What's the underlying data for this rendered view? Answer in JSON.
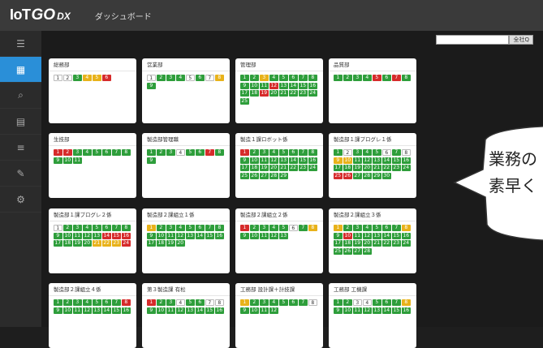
{
  "header": {
    "logo_iot": "IoT",
    "logo_go": "GO",
    "logo_dx": "DX",
    "title": "ダッシュボード"
  },
  "sidebar": {
    "icons": [
      "menu-icon",
      "dashboard-icon",
      "search-icon",
      "calendar-icon",
      "list-icon",
      "edit-icon",
      "gear-icon"
    ]
  },
  "search": {
    "value": "",
    "button": "全社Q"
  },
  "cards": [
    {
      "title": "総務部",
      "cells": [
        [
          "1",
          "w"
        ],
        [
          "2",
          "w"
        ],
        [
          "3",
          "g"
        ],
        [
          "4",
          "y"
        ],
        [
          "5",
          "y"
        ],
        [
          "6",
          "r"
        ]
      ]
    },
    {
      "title": "営業部",
      "cells": [
        [
          "1",
          "w"
        ],
        [
          "2",
          "g"
        ],
        [
          "3",
          "g"
        ],
        [
          "4",
          "g"
        ],
        [
          "5",
          "w"
        ],
        [
          "6",
          "g"
        ],
        [
          "7",
          "w"
        ],
        [
          "8",
          "y"
        ],
        [
          "9",
          "g"
        ]
      ]
    },
    {
      "title": "管理部",
      "cells": [
        [
          "1",
          "g"
        ],
        [
          "2",
          "g"
        ],
        [
          "3",
          "y"
        ],
        [
          "4",
          "g"
        ],
        [
          "5",
          "g"
        ],
        [
          "6",
          "g"
        ],
        [
          "7",
          "g"
        ],
        [
          "8",
          "g"
        ],
        [
          "9",
          "g"
        ],
        [
          "10",
          "g"
        ],
        [
          "11",
          "g"
        ],
        [
          "12",
          "r"
        ],
        [
          "13",
          "g"
        ],
        [
          "14",
          "g"
        ],
        [
          "15",
          "g"
        ],
        [
          "16",
          "g"
        ],
        [
          "17",
          "g"
        ],
        [
          "18",
          "g"
        ],
        [
          "19",
          "r"
        ],
        [
          "20",
          "g"
        ],
        [
          "21",
          "g"
        ],
        [
          "22",
          "g"
        ],
        [
          "23",
          "g"
        ],
        [
          "24",
          "g"
        ],
        [
          "25",
          "g"
        ]
      ]
    },
    {
      "title": "品質部",
      "cells": [
        [
          "1",
          "g"
        ],
        [
          "2",
          "g"
        ],
        [
          "3",
          "g"
        ],
        [
          "4",
          "g"
        ],
        [
          "5",
          "r"
        ],
        [
          "6",
          "g"
        ],
        [
          "7",
          "r"
        ],
        [
          "8",
          "g"
        ]
      ]
    },
    {
      "title": "生技部",
      "cells": [
        [
          "1",
          "r"
        ],
        [
          "2",
          "r"
        ],
        [
          "3",
          "g"
        ],
        [
          "4",
          "g"
        ],
        [
          "5",
          "g"
        ],
        [
          "6",
          "g"
        ],
        [
          "7",
          "g"
        ],
        [
          "8",
          "g"
        ],
        [
          "9",
          "g"
        ],
        [
          "10",
          "g"
        ],
        [
          "11",
          "g"
        ]
      ]
    },
    {
      "title": "製造部管理職",
      "cells": [
        [
          "1",
          "g"
        ],
        [
          "2",
          "g"
        ],
        [
          "3",
          "g"
        ],
        [
          "4",
          "w"
        ],
        [
          "5",
          "g"
        ],
        [
          "6",
          "g"
        ],
        [
          "7",
          "r"
        ],
        [
          "8",
          "g"
        ],
        [
          "9",
          "g"
        ]
      ]
    },
    {
      "title": "製造１課ロボット係",
      "cells": [
        [
          "1",
          "r"
        ],
        [
          "2",
          "g"
        ],
        [
          "3",
          "g"
        ],
        [
          "4",
          "g"
        ],
        [
          "5",
          "g"
        ],
        [
          "6",
          "g"
        ],
        [
          "7",
          "g"
        ],
        [
          "8",
          "g"
        ],
        [
          "9",
          "g"
        ],
        [
          "10",
          "g"
        ],
        [
          "11",
          "g"
        ],
        [
          "12",
          "g"
        ],
        [
          "13",
          "g"
        ],
        [
          "14",
          "g"
        ],
        [
          "15",
          "g"
        ],
        [
          "16",
          "g"
        ],
        [
          "17",
          "g"
        ],
        [
          "18",
          "g"
        ],
        [
          "19",
          "g"
        ],
        [
          "20",
          "g"
        ],
        [
          "21",
          "g"
        ],
        [
          "22",
          "g"
        ],
        [
          "23",
          "g"
        ],
        [
          "24",
          "g"
        ],
        [
          "25",
          "g"
        ],
        [
          "26",
          "g"
        ],
        [
          "27",
          "g"
        ],
        [
          "28",
          "g"
        ],
        [
          "29",
          "g"
        ]
      ]
    },
    {
      "title": "製造部１課プログレ１係",
      "cells": [
        [
          "1",
          "g"
        ],
        [
          "2",
          "w"
        ],
        [
          "3",
          "g"
        ],
        [
          "4",
          "g"
        ],
        [
          "5",
          "g"
        ],
        [
          "6",
          "w"
        ],
        [
          "7",
          "g"
        ],
        [
          "8",
          "w"
        ],
        [
          "9",
          "y"
        ],
        [
          "10",
          "y"
        ],
        [
          "11",
          "g"
        ],
        [
          "12",
          "g"
        ],
        [
          "13",
          "g"
        ],
        [
          "14",
          "g"
        ],
        [
          "15",
          "g"
        ],
        [
          "16",
          "g"
        ],
        [
          "17",
          "g"
        ],
        [
          "18",
          "g"
        ],
        [
          "19",
          "g"
        ],
        [
          "20",
          "g"
        ],
        [
          "21",
          "g"
        ],
        [
          "22",
          "g"
        ],
        [
          "23",
          "g"
        ],
        [
          "24",
          "g"
        ],
        [
          "25",
          "r"
        ],
        [
          "26",
          "r"
        ],
        [
          "27",
          "g"
        ],
        [
          "28",
          "g"
        ],
        [
          "29",
          "g"
        ],
        [
          "30",
          "g"
        ]
      ]
    },
    {
      "title": "製造部１課プログレ２係",
      "cells": [
        [
          "1",
          "w"
        ],
        [
          "2",
          "g"
        ],
        [
          "3",
          "g"
        ],
        [
          "4",
          "g"
        ],
        [
          "5",
          "g"
        ],
        [
          "6",
          "g"
        ],
        [
          "7",
          "g"
        ],
        [
          "8",
          "g"
        ],
        [
          "9",
          "g"
        ],
        [
          "10",
          "g"
        ],
        [
          "11",
          "g"
        ],
        [
          "12",
          "g"
        ],
        [
          "13",
          "g"
        ],
        [
          "14",
          "r"
        ],
        [
          "15",
          "r"
        ],
        [
          "16",
          "r"
        ],
        [
          "17",
          "g"
        ],
        [
          "18",
          "g"
        ],
        [
          "19",
          "g"
        ],
        [
          "20",
          "g"
        ],
        [
          "21",
          "y"
        ],
        [
          "22",
          "y"
        ],
        [
          "23",
          "y"
        ],
        [
          "24",
          "r"
        ]
      ]
    },
    {
      "title": "製造部２課組立１係",
      "cells": [
        [
          "1",
          "y"
        ],
        [
          "2",
          "g"
        ],
        [
          "3",
          "g"
        ],
        [
          "4",
          "g"
        ],
        [
          "5",
          "g"
        ],
        [
          "6",
          "g"
        ],
        [
          "7",
          "g"
        ],
        [
          "8",
          "g"
        ],
        [
          "9",
          "g"
        ],
        [
          "10",
          "g"
        ],
        [
          "11",
          "g"
        ],
        [
          "12",
          "g"
        ],
        [
          "13",
          "g"
        ],
        [
          "14",
          "g"
        ],
        [
          "15",
          "g"
        ],
        [
          "16",
          "g"
        ],
        [
          "17",
          "g"
        ],
        [
          "18",
          "g"
        ],
        [
          "19",
          "g"
        ],
        [
          "20",
          "g"
        ]
      ]
    },
    {
      "title": "製造部２課組立２係",
      "cells": [
        [
          "1",
          "r"
        ],
        [
          "2",
          "g"
        ],
        [
          "3",
          "g"
        ],
        [
          "4",
          "g"
        ],
        [
          "5",
          "g"
        ],
        [
          "6",
          "w"
        ],
        [
          "7",
          "g"
        ],
        [
          "8",
          "y"
        ],
        [
          "9",
          "g"
        ],
        [
          "10",
          "g"
        ],
        [
          "11",
          "g"
        ],
        [
          "12",
          "g"
        ],
        [
          "13",
          "g"
        ]
      ]
    },
    {
      "title": "製造部２課組立３係",
      "cells": [
        [
          "1",
          "y"
        ],
        [
          "2",
          "g"
        ],
        [
          "3",
          "g"
        ],
        [
          "4",
          "g"
        ],
        [
          "5",
          "g"
        ],
        [
          "6",
          "g"
        ],
        [
          "7",
          "g"
        ],
        [
          "8",
          "y"
        ],
        [
          "9",
          "g"
        ],
        [
          "10",
          "r"
        ],
        [
          "11",
          "g"
        ],
        [
          "12",
          "g"
        ],
        [
          "13",
          "g"
        ],
        [
          "14",
          "g"
        ],
        [
          "15",
          "g"
        ],
        [
          "16",
          "g"
        ],
        [
          "17",
          "g"
        ],
        [
          "18",
          "g"
        ],
        [
          "19",
          "g"
        ],
        [
          "20",
          "g"
        ],
        [
          "21",
          "g"
        ],
        [
          "22",
          "g"
        ],
        [
          "23",
          "g"
        ],
        [
          "24",
          "g"
        ],
        [
          "25",
          "g"
        ],
        [
          "26",
          "g"
        ],
        [
          "27",
          "g"
        ],
        [
          "28",
          "g"
        ]
      ]
    },
    {
      "title": "製造部２課組立４係",
      "cells": [
        [
          "1",
          "g"
        ],
        [
          "2",
          "g"
        ],
        [
          "3",
          "g"
        ],
        [
          "4",
          "g"
        ],
        [
          "5",
          "g"
        ],
        [
          "6",
          "g"
        ],
        [
          "7",
          "g"
        ],
        [
          "8",
          "r"
        ],
        [
          "9",
          "g"
        ],
        [
          "10",
          "g"
        ],
        [
          "11",
          "g"
        ],
        [
          "12",
          "g"
        ],
        [
          "13",
          "g"
        ],
        [
          "14",
          "g"
        ],
        [
          "15",
          "g"
        ],
        [
          "16",
          "g"
        ]
      ]
    },
    {
      "title": "第３製造課 有松",
      "cells": [
        [
          "1",
          "r"
        ],
        [
          "2",
          "g"
        ],
        [
          "3",
          "g"
        ],
        [
          "4",
          "w"
        ],
        [
          "5",
          "g"
        ],
        [
          "6",
          "g"
        ],
        [
          "7",
          "w"
        ],
        [
          "8",
          "w"
        ],
        [
          "9",
          "g"
        ],
        [
          "10",
          "g"
        ],
        [
          "11",
          "g"
        ],
        [
          "12",
          "g"
        ],
        [
          "13",
          "g"
        ],
        [
          "14",
          "g"
        ],
        [
          "15",
          "g"
        ],
        [
          "16",
          "g"
        ]
      ]
    },
    {
      "title": "工務部 設計課＋計技課",
      "cells": [
        [
          "1",
          "y"
        ],
        [
          "2",
          "g"
        ],
        [
          "3",
          "g"
        ],
        [
          "4",
          "g"
        ],
        [
          "5",
          "g"
        ],
        [
          "6",
          "g"
        ],
        [
          "7",
          "g"
        ],
        [
          "8",
          "w"
        ],
        [
          "9",
          "g"
        ],
        [
          "10",
          "g"
        ],
        [
          "11",
          "g"
        ],
        [
          "12",
          "g"
        ]
      ]
    },
    {
      "title": "工務部 工機課",
      "cells": [
        [
          "1",
          "g"
        ],
        [
          "2",
          "g"
        ],
        [
          "3",
          "w"
        ],
        [
          "4",
          "w"
        ],
        [
          "5",
          "g"
        ],
        [
          "6",
          "g"
        ],
        [
          "7",
          "g"
        ],
        [
          "8",
          "y"
        ],
        [
          "9",
          "g"
        ],
        [
          "10",
          "g"
        ],
        [
          "11",
          "g"
        ],
        [
          "12",
          "g"
        ],
        [
          "13",
          "g"
        ],
        [
          "14",
          "g"
        ],
        [
          "15",
          "g"
        ],
        [
          "16",
          "g"
        ]
      ]
    }
  ],
  "callout": {
    "line1": "業務の",
    "line2": "素早く"
  }
}
